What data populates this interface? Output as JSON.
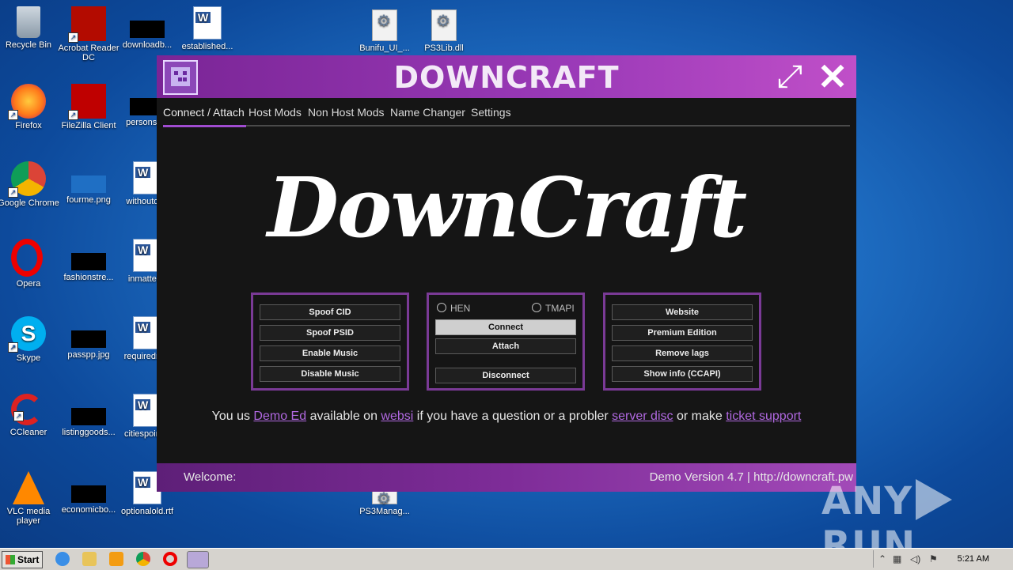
{
  "desktop": {
    "icons": [
      {
        "label": "Recycle Bin"
      },
      {
        "label": "Acrobat Reader DC"
      },
      {
        "label": "downloadb..."
      },
      {
        "label": "established..."
      },
      {
        "label": "Bunifu_UI_..."
      },
      {
        "label": "PS3Lib.dll"
      },
      {
        "label": "Firefox"
      },
      {
        "label": "FileZilla Client"
      },
      {
        "label": "personsc..."
      },
      {
        "label": "Google Chrome"
      },
      {
        "label": "fourme.png"
      },
      {
        "label": "withoutor..."
      },
      {
        "label": "Opera"
      },
      {
        "label": "fashionstre..."
      },
      {
        "label": "inmatter..."
      },
      {
        "label": "Skype"
      },
      {
        "label": "passpp.jpg"
      },
      {
        "label": "requiredm..."
      },
      {
        "label": "CCleaner"
      },
      {
        "label": "listinggoods..."
      },
      {
        "label": "citiespoint..."
      },
      {
        "label": "VLC media player"
      },
      {
        "label": "economicbo..."
      },
      {
        "label": "optionalold.rtf"
      },
      {
        "label": "PS3Manag..."
      }
    ]
  },
  "app": {
    "title": "DOWNCRAFT",
    "max_glyph": "⤢",
    "close_glyph": "✕",
    "tabs": [
      "Connect / Attach",
      "Host Mods",
      "Non Host Mods",
      "Name Changer",
      "Settings"
    ],
    "logo_text": "DownCraft",
    "left_panel": [
      "Spoof CID",
      "Spoof PSID",
      "Enable Music",
      "Disable Music"
    ],
    "middle_panel": {
      "radio_hen": "HEN",
      "radio_tmapi": "TMAPI",
      "connect": "Connect",
      "attach": "Attach",
      "disconnect": "Disconnect"
    },
    "right_panel": [
      "Website",
      "Premium Edition",
      "Remove lags",
      "Show info (CCAPI)"
    ],
    "info": {
      "t1": "You us ",
      "l1": "Demo Ed",
      "t2": " available on ",
      "l2": "websi",
      "t3": " if you have a question or a probler ",
      "l3": "server disc",
      "t4": " or make ",
      "l4": "ticket support"
    },
    "footer": {
      "welcome": "Welcome:",
      "version": "Demo Version 4.7 | http://downcraft.pw"
    }
  },
  "taskbar": {
    "start": "Start",
    "clock": "5:21 AM"
  },
  "watermark": {
    "left": "ANY",
    "right": "RUN"
  }
}
